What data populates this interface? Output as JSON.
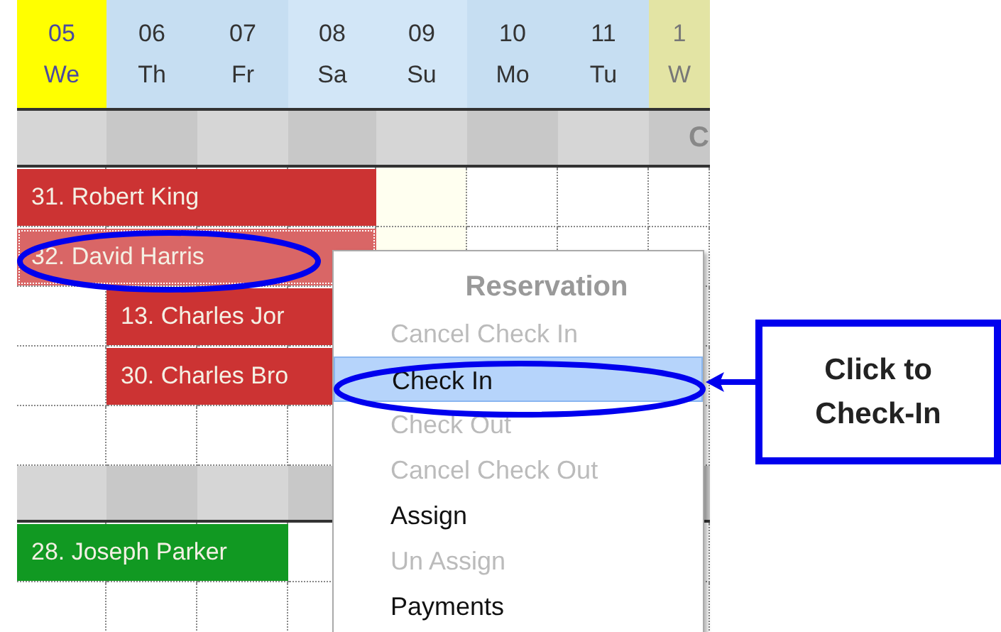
{
  "days": [
    {
      "number": "05",
      "weekday": "We",
      "kind": "today"
    },
    {
      "number": "06",
      "weekday": "Th",
      "kind": "weekday"
    },
    {
      "number": "07",
      "weekday": "Fr",
      "kind": "weekday"
    },
    {
      "number": "08",
      "weekday": "Sa",
      "kind": "weekend"
    },
    {
      "number": "09",
      "weekday": "Su",
      "kind": "weekend"
    },
    {
      "number": "10",
      "weekday": "Mo",
      "kind": "weekday"
    },
    {
      "number": "11",
      "weekday": "Tu",
      "kind": "weekday"
    },
    {
      "number": "1",
      "weekday": "W",
      "kind": "marked"
    }
  ],
  "rows": [
    {
      "kind": "group",
      "label": "C"
    },
    {
      "kind": "room",
      "booking": {
        "label": "31. Robert King",
        "color": "#cc3333",
        "selected": false
      }
    },
    {
      "kind": "room",
      "booking": {
        "label": "32. David Harris",
        "color": "#d96666",
        "selected": true
      }
    },
    {
      "kind": "room",
      "booking": {
        "label": "13. Charles Jor",
        "color": "#cc3333",
        "selected": false
      }
    },
    {
      "kind": "room",
      "booking": {
        "label": "30. Charles Bro",
        "color": "#cc3333",
        "selected": false
      }
    },
    {
      "kind": "room"
    },
    {
      "kind": "group"
    },
    {
      "kind": "room",
      "booking": {
        "label": "28. Joseph Parker",
        "color": "#119922",
        "selected": false
      }
    },
    {
      "kind": "room"
    }
  ],
  "context_menu": {
    "title": "Reservation",
    "items": [
      {
        "label": "Cancel Check In",
        "disabled": true,
        "selected": false
      },
      {
        "label": "Check In",
        "disabled": false,
        "selected": true
      },
      {
        "label": "Check Out",
        "disabled": true,
        "selected": false
      },
      {
        "label": "Cancel Check Out",
        "disabled": true,
        "selected": false
      },
      {
        "label": "Assign",
        "disabled": false,
        "selected": false
      },
      {
        "label": "Un Assign",
        "disabled": true,
        "selected": false
      },
      {
        "label": "Payments",
        "disabled": false,
        "selected": false
      }
    ]
  },
  "callout": {
    "text": "Click to\nCheck-In"
  }
}
